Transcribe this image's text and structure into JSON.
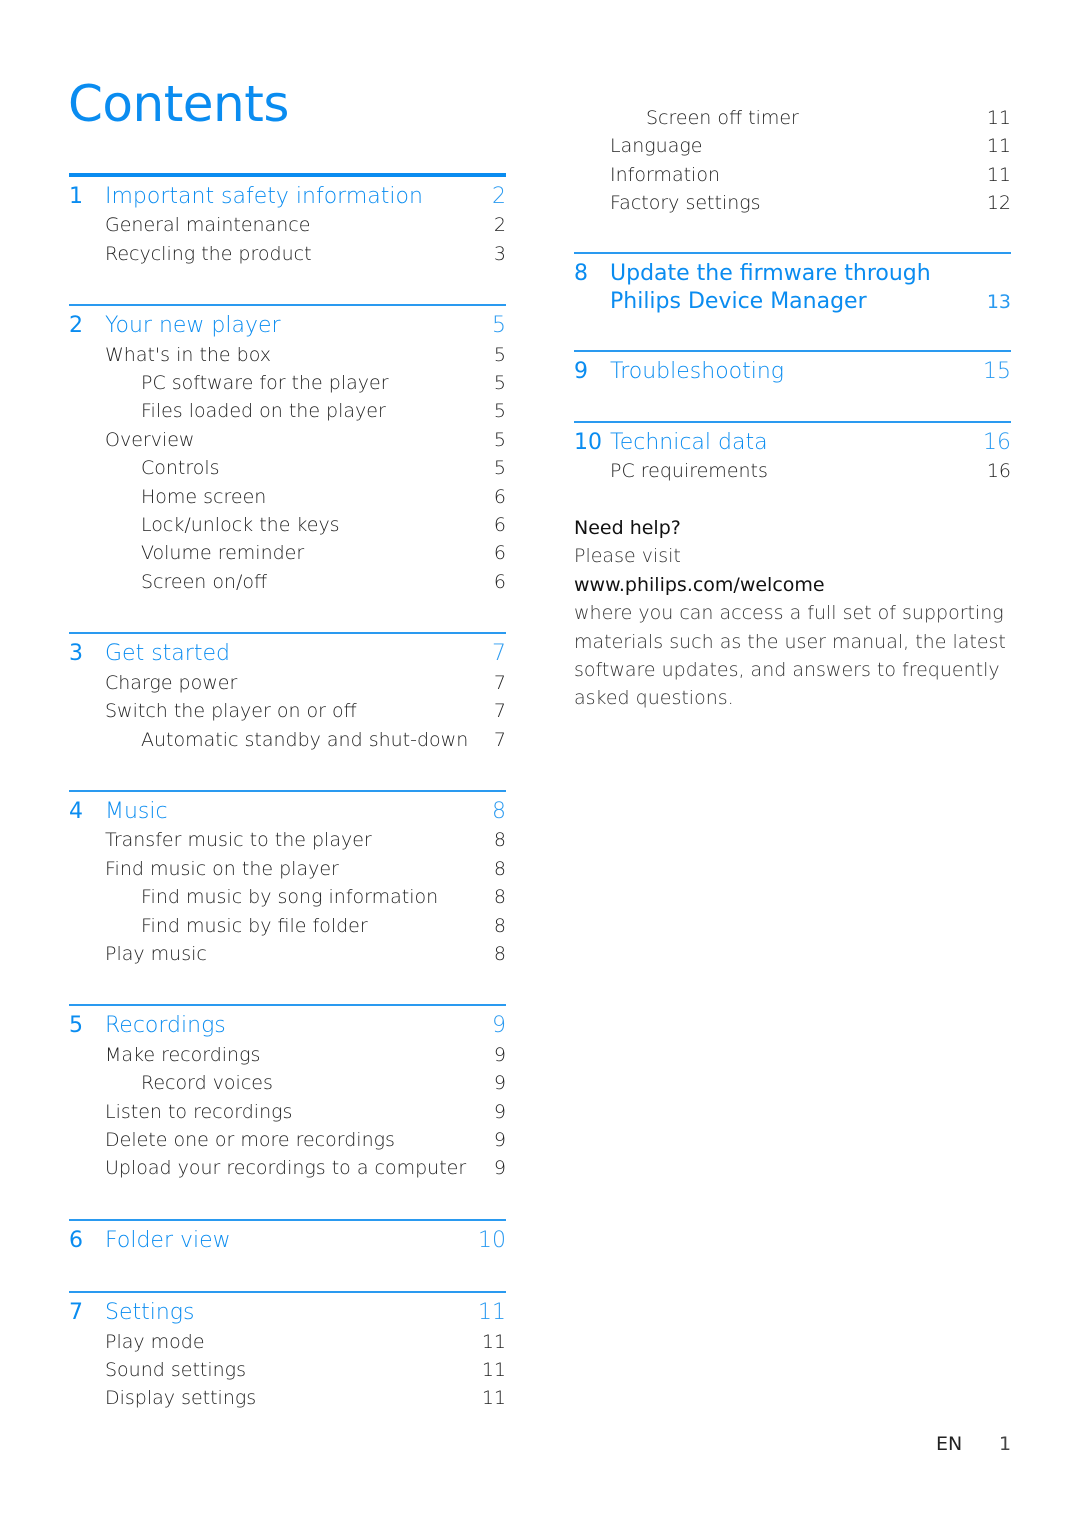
{
  "page_title": "Contents",
  "accent_color": "#0a8cf0",
  "sections": [
    {
      "num": "1",
      "title": "Important safety information",
      "page": "2",
      "items": [
        {
          "label": "General maintenance",
          "page": "2",
          "level": 1
        },
        {
          "label": "Recycling the product",
          "page": "3",
          "level": 1
        }
      ]
    },
    {
      "num": "2",
      "title": "Your new player",
      "page": "5",
      "items": [
        {
          "label": "What's in the box",
          "page": "5",
          "level": 1
        },
        {
          "label": "PC software for the player",
          "page": "5",
          "level": 2
        },
        {
          "label": "Files loaded on the player",
          "page": "5",
          "level": 2
        },
        {
          "label": "Overview",
          "page": "5",
          "level": 1
        },
        {
          "label": "Controls",
          "page": "5",
          "level": 2
        },
        {
          "label": "Home screen",
          "page": "6",
          "level": 2
        },
        {
          "label": "Lock/unlock the keys",
          "page": "6",
          "level": 2
        },
        {
          "label": "Volume reminder",
          "page": "6",
          "level": 2
        },
        {
          "label": "Screen on/off",
          "page": "6",
          "level": 2
        }
      ]
    },
    {
      "num": "3",
      "title": "Get started",
      "page": "7",
      "items": [
        {
          "label": "Charge power",
          "page": "7",
          "level": 1
        },
        {
          "label": "Switch the player on or off",
          "page": "7",
          "level": 1
        },
        {
          "label": "Automatic standby and shut-down",
          "page": "7",
          "level": 2
        }
      ]
    },
    {
      "num": "4",
      "title": "Music",
      "page": "8",
      "items": [
        {
          "label": "Transfer music to the player",
          "page": "8",
          "level": 1
        },
        {
          "label": "Find music on the player",
          "page": "8",
          "level": 1
        },
        {
          "label": "Find music by song information",
          "page": "8",
          "level": 2
        },
        {
          "label": "Find music by file folder",
          "page": "8",
          "level": 2
        },
        {
          "label": "Play music",
          "page": "8",
          "level": 1
        }
      ]
    },
    {
      "num": "5",
      "title": "Recordings",
      "page": "9",
      "items": [
        {
          "label": "Make recordings",
          "page": "9",
          "level": 1
        },
        {
          "label": "Record voices",
          "page": "9",
          "level": 2
        },
        {
          "label": "Listen to recordings",
          "page": "9",
          "level": 1
        },
        {
          "label": "Delete one or more recordings",
          "page": "9",
          "level": 1
        },
        {
          "label": "Upload your recordings to a computer",
          "page": "9",
          "level": 1
        }
      ]
    },
    {
      "num": "6",
      "title": "Folder view",
      "page": "10",
      "items": []
    },
    {
      "num": "7",
      "title": "Settings",
      "page": "11",
      "items": [
        {
          "label": "Play mode",
          "page": "11",
          "level": 1
        },
        {
          "label": "Sound settings",
          "page": "11",
          "level": 1
        },
        {
          "label": "Display settings",
          "page": "11",
          "level": 1
        }
      ]
    }
  ],
  "settings_continued": [
    {
      "label": "Screen off timer",
      "page": "11",
      "level": 2
    },
    {
      "label": "Language",
      "page": "11",
      "level": 1
    },
    {
      "label": "Information",
      "page": "11",
      "level": 1
    },
    {
      "label": "Factory settings",
      "page": "12",
      "level": 1
    }
  ],
  "right_sections": [
    {
      "num": "8",
      "title_line1": "Update the firmware through",
      "title_line2": "Philips Device Manager",
      "page": "13",
      "items": []
    },
    {
      "num": "9",
      "title": "Troubleshooting",
      "page": "15",
      "items": []
    },
    {
      "num": "10",
      "title": "Technical data",
      "page": "16",
      "items": [
        {
          "label": "PC requirements",
          "page": "16",
          "level": 1
        }
      ]
    }
  ],
  "help": {
    "heading": "Need help?",
    "line1": "Please visit",
    "url": "www.philips.com/welcome",
    "body_lines": [
      "where you can access a full set of supporting",
      "materials such as the user manual, the latest",
      "software updates, and answers to frequently",
      "asked questions."
    ]
  },
  "footer": {
    "language": "EN",
    "page_number": "1"
  }
}
